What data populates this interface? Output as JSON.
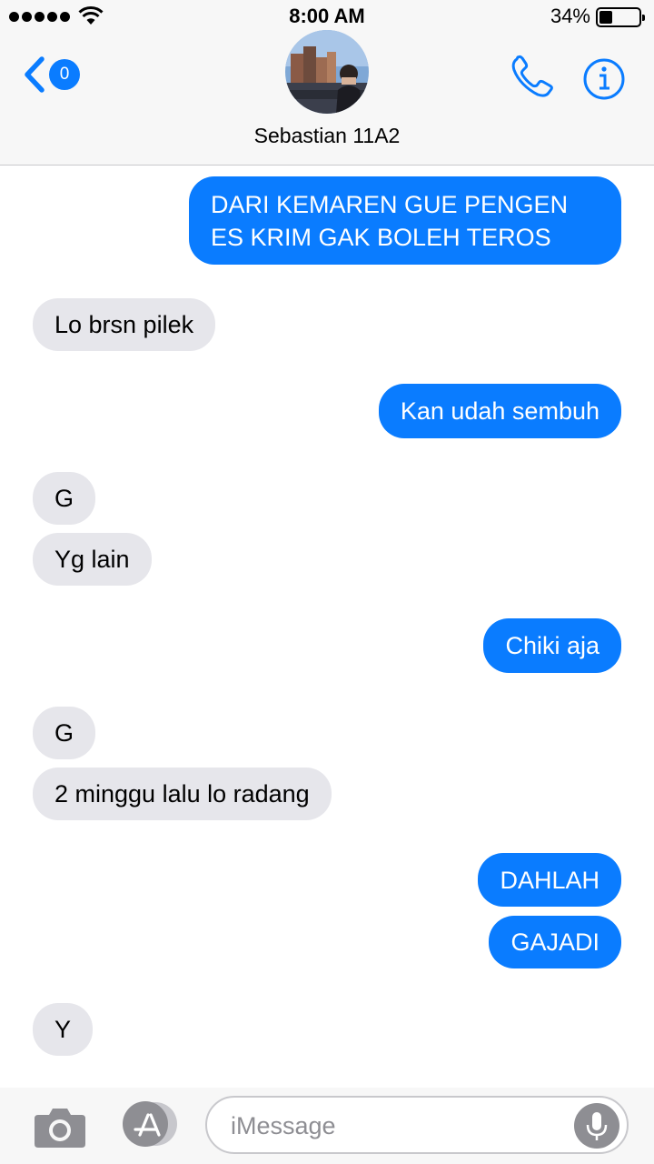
{
  "status_bar": {
    "time": "8:00 AM",
    "battery_percent": "34%",
    "battery_level": 0.34,
    "signal_bars": 5
  },
  "header": {
    "back_badge": "0",
    "contact_name": "Sebastian 11A2",
    "icons": [
      "back-chevron-icon",
      "phone-icon",
      "info-icon"
    ]
  },
  "messages": [
    {
      "side": "out",
      "text": "DARI KEMAREN GUE PENGEN ES KRIM GAK BOLEH TEROS"
    },
    {
      "side": "in",
      "text": "Lo brsn pilek"
    },
    {
      "side": "out",
      "text": "Kan udah sembuh"
    },
    {
      "side": "in",
      "text": "G"
    },
    {
      "side": "in",
      "text": "Yg lain"
    },
    {
      "side": "out",
      "text": "Chiki aja"
    },
    {
      "side": "in",
      "text": "G"
    },
    {
      "side": "in",
      "text": "2 minggu lalu lo radang"
    },
    {
      "side": "out",
      "text": "DAHLAH"
    },
    {
      "side": "out",
      "text": "GAJADI"
    },
    {
      "side": "in",
      "text": "Y"
    }
  ],
  "input_bar": {
    "placeholder": "iMessage",
    "value": "",
    "icons": [
      "camera-icon",
      "app-store-icon",
      "microphone-icon"
    ]
  },
  "colors": {
    "outgoing_bubble": "#0a7cff",
    "incoming_bubble": "#e6e6eb",
    "accent": "#0a7cff"
  }
}
